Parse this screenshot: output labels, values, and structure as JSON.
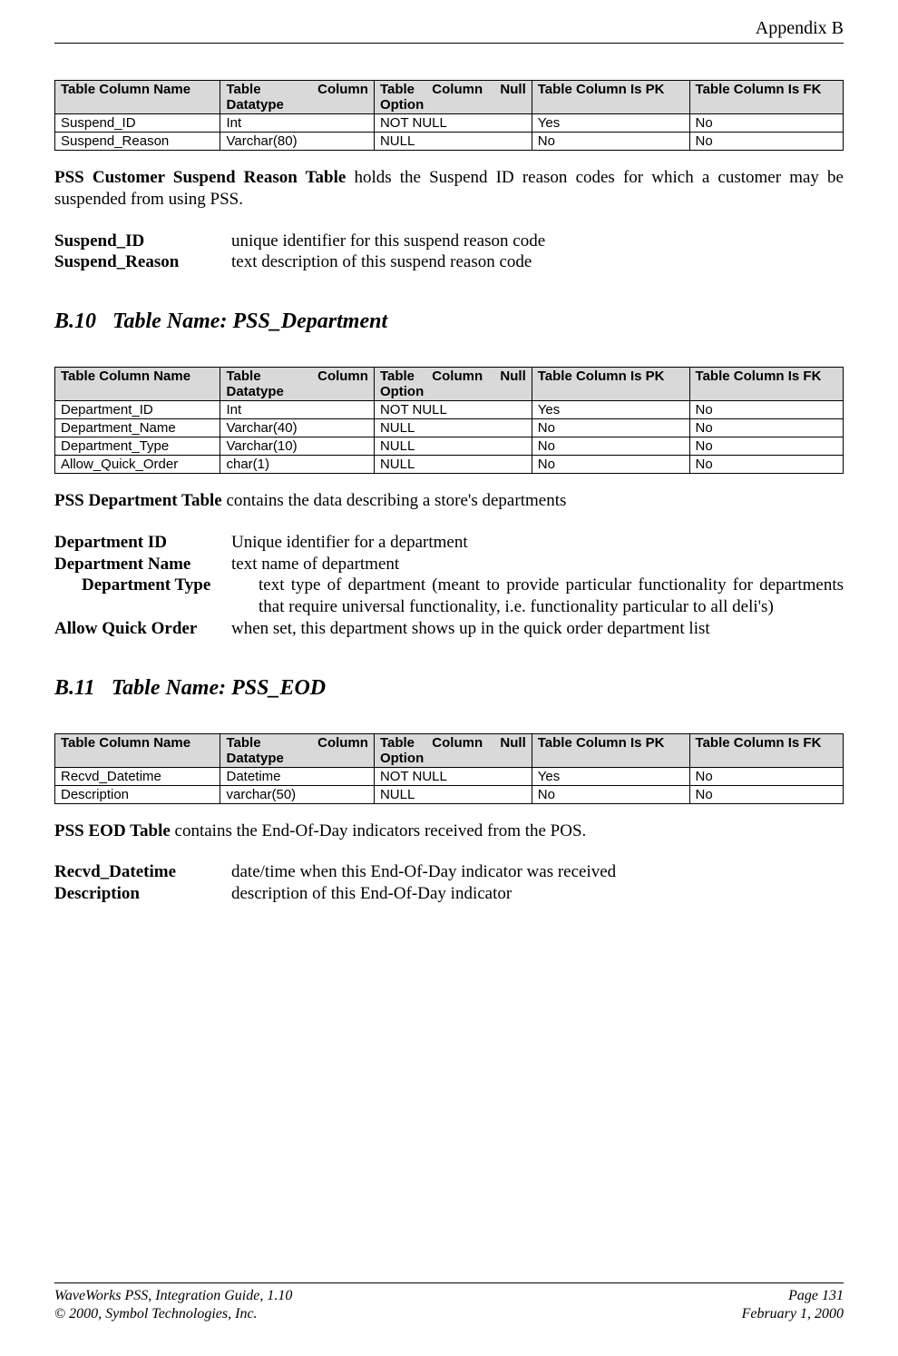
{
  "header": {
    "appendix": "Appendix B"
  },
  "table_headers": {
    "col1": "Table Column Name",
    "col2a": "Table",
    "col2b": "Column",
    "col2c": "Datatype",
    "col3a": "Table",
    "col3b": "Column",
    "col3c": "Null",
    "col3d": "Option",
    "col4": "Table Column Is PK",
    "col5": "Table Column Is FK"
  },
  "section1": {
    "table_rows": [
      {
        "name": "Suspend_ID",
        "type": "Int",
        "nulls": "NOT NULL",
        "pk": "Yes",
        "fk": "No"
      },
      {
        "name": "Suspend_Reason",
        "type": "Varchar(80)",
        "nulls": "NULL",
        "pk": "No",
        "fk": "No"
      }
    ],
    "desc_bold": "PSS Customer Suspend Reason Table",
    "desc_rest": " holds the Suspend ID reason codes for which a customer may be suspended from using PSS.",
    "defs": [
      {
        "term": "Suspend_ID",
        "desc": "unique identifier for this suspend reason code"
      },
      {
        "term": "Suspend_Reason",
        "desc": "text description of this suspend reason code"
      }
    ]
  },
  "section2": {
    "heading_num": "B.10",
    "heading_text": "Table Name: PSS_Department",
    "table_rows": [
      {
        "name": "Department_ID",
        "type": "Int",
        "nulls": "NOT NULL",
        "pk": "Yes",
        "fk": "No"
      },
      {
        "name": "Department_Name",
        "type": "Varchar(40)",
        "nulls": "NULL",
        "pk": "No",
        "fk": "No"
      },
      {
        "name": "Department_Type",
        "type": "Varchar(10)",
        "nulls": "NULL",
        "pk": "No",
        "fk": "No"
      },
      {
        "name": "Allow_Quick_Order",
        "type": "char(1)",
        "nulls": "NULL",
        "pk": "No",
        "fk": "No"
      }
    ],
    "desc_bold": "PSS Department Table",
    "desc_rest": " contains the data describing a store's departments",
    "defs": [
      {
        "term": "Department ID",
        "indent": false,
        "desc": "Unique identifier for a department"
      },
      {
        "term": "Department Name",
        "indent": false,
        "desc": "text name of department"
      },
      {
        "term": "Department Type",
        "indent": true,
        "desc": "text type of department (meant to provide particular functionality for departments that require universal functionality, i.e. functionality particular to all deli's)"
      },
      {
        "term": "Allow Quick Order",
        "indent": false,
        "desc": "when set, this department shows up in the quick order department list"
      }
    ]
  },
  "section3": {
    "heading_num": "B.11",
    "heading_text": "Table Name: PSS_EOD",
    "table_rows": [
      {
        "name": "Recvd_Datetime",
        "type": "Datetime",
        "nulls": "NOT NULL",
        "pk": "Yes",
        "fk": "No"
      },
      {
        "name": "Description",
        "type": "varchar(50)",
        "nulls": "NULL",
        "pk": "No",
        "fk": "No"
      }
    ],
    "desc_bold": "PSS EOD Table",
    "desc_rest": " contains the End-Of-Day indicators received from the POS.",
    "defs": [
      {
        "term": "Recvd_Datetime",
        "desc": "date/time when this End-Of-Day indicator was received"
      },
      {
        "term": "Description",
        "desc": "description of this End-Of-Day indicator"
      }
    ]
  },
  "footer": {
    "left1": "WaveWorks PSS, Integration Guide, 1.10",
    "left2": "© 2000, Symbol Technologies, Inc.",
    "right1": "Page 131",
    "right2": "February 1, 2000"
  }
}
